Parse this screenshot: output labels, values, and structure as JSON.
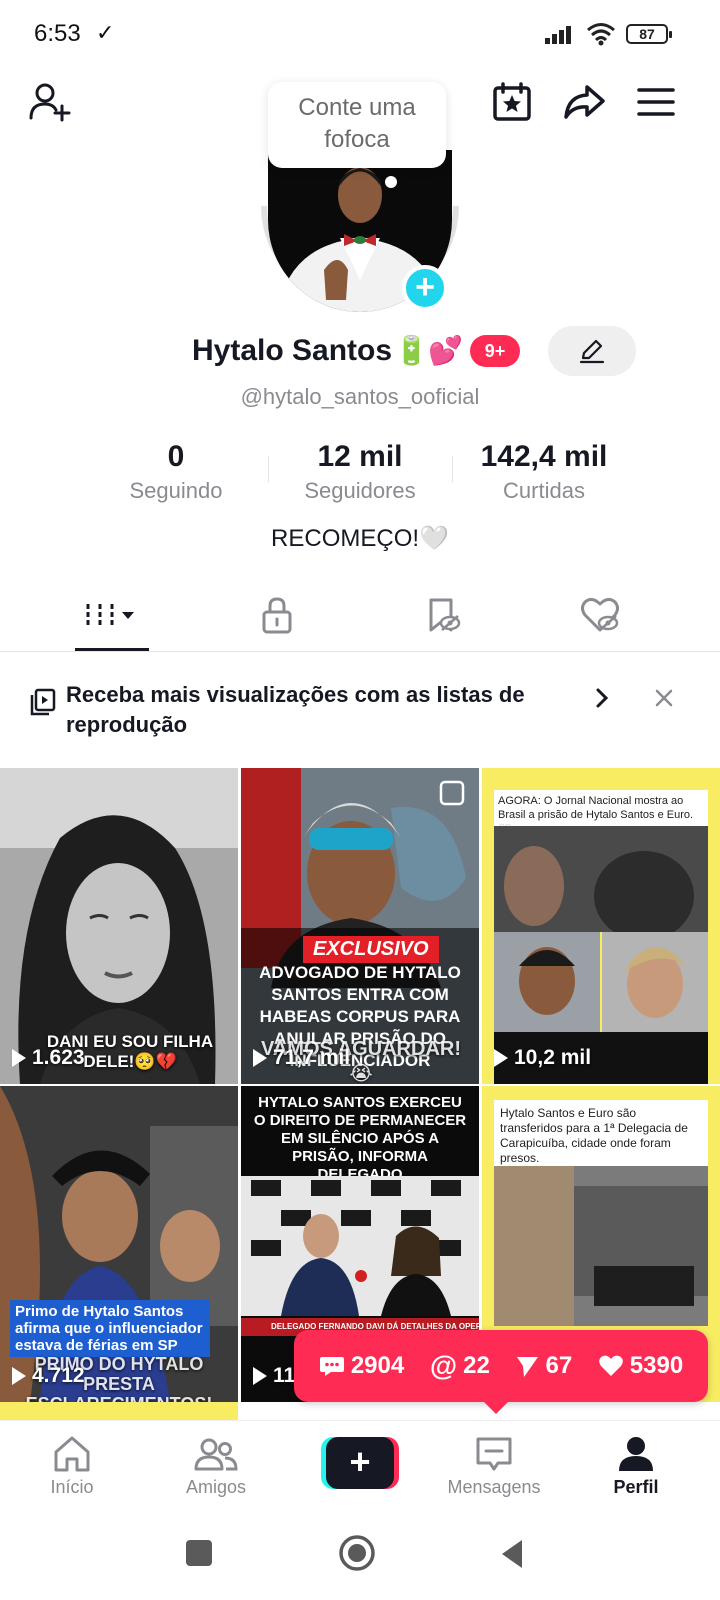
{
  "status": {
    "time": "6:53",
    "battery": "87"
  },
  "bubble": {
    "text": "Conte uma fofoca"
  },
  "profile": {
    "name": "Hytalo Santos",
    "badge_count": "9+",
    "handle": "@hytalo_santos_ooficial",
    "bio": "RECOMEÇO!🤍"
  },
  "stats": [
    {
      "value": "0",
      "label": "Seguindo"
    },
    {
      "value": "12 mil",
      "label": "Seguidores"
    },
    {
      "value": "142,4 mil",
      "label": "Curtidas"
    }
  ],
  "banner": {
    "text": "Receba mais visualizações com as listas de reprodução"
  },
  "videos": [
    {
      "views": "1.623",
      "overlay": "DANI EU SOU FILHA DELE!🥺💔"
    },
    {
      "views": "71,7 mil",
      "tag": "EXCLUSIVO",
      "headline": "ADVOGADO DE HYTALO SANTOS ENTRA COM HABEAS CORPUS PARA ANULAR PRISÃO DO INFLUENCIADOR",
      "overlay": "VAMOS AGUARDAR!😭"
    },
    {
      "views": "10,2 mil",
      "caption": "AGORA: O Jornal Nacional mostra ao Brasil a prisão de Hytalo Santos e Euro. 👀"
    },
    {
      "views": "4.712",
      "caption": "Primo de Hytalo Santos afirma que o influenciador estava de férias em SP",
      "overlay": "PRIMO DO HYTALO PRESTA ESCLARECIMENTOS!"
    },
    {
      "views": "11",
      "headline": "HYTALO SANTOS EXERCEU O DIREITO DE PERMANECER EM SILÊNCIO APÓS A PRISÃO, INFORMA DELEGADO",
      "ticker": "DELEGADO FERNANDO DAVI DÁ DETALHES DA OPERAÇÃO QUE PRENDEU HYTALO SANTOS"
    },
    {
      "views": "",
      "caption": "Hytalo Santos e Euro são transferidos para a 1ª Delegacia de Carapicuíba, cidade onde foram presos."
    }
  ],
  "notifications": {
    "comments": "2904",
    "mentions": "22",
    "shares": "67",
    "likes": "5390"
  },
  "nav": {
    "home": "Início",
    "friends": "Amigos",
    "messages": "Mensagens",
    "profile": "Perfil"
  },
  "colors": {
    "accent": "#fe2c55",
    "cyan": "#25f4ee",
    "text": "#161823",
    "muted": "#8a8b91"
  }
}
